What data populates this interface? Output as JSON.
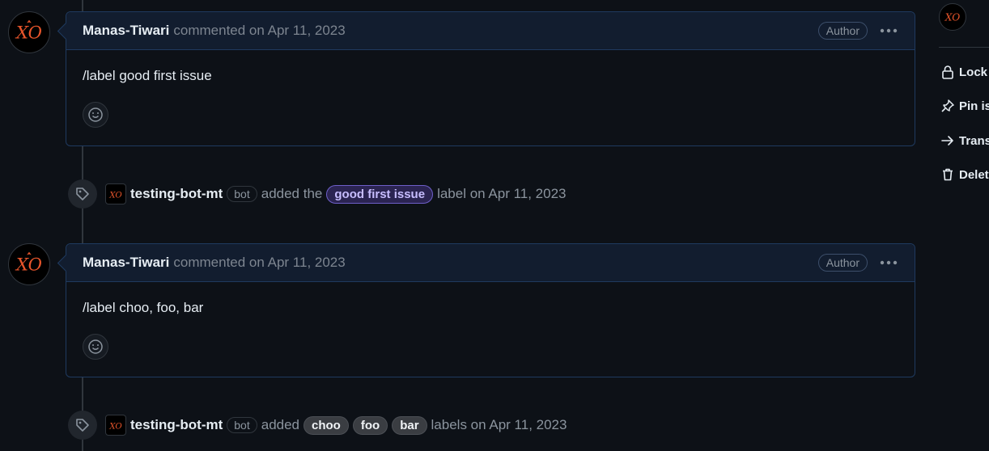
{
  "comments": [
    {
      "author": "Manas-Tiwari",
      "meta": "commented on Apr 11, 2023",
      "badge": "Author",
      "body": "/label good first issue"
    },
    {
      "author": "Manas-Tiwari",
      "meta": "commented on Apr 11, 2023",
      "badge": "Author",
      "body": "/label choo, foo, bar"
    }
  ],
  "events": [
    {
      "actor": "testing-bot-mt",
      "badge": "bot",
      "action": "added the",
      "labels": [
        "good first issue"
      ],
      "suffix": "label on Apr 11, 2023"
    },
    {
      "actor": "testing-bot-mt",
      "badge": "bot",
      "action": "added",
      "labels": [
        "choo",
        "foo",
        "bar"
      ],
      "suffix": "labels on Apr 11, 2023"
    }
  ],
  "sidebar": {
    "items": [
      {
        "label": "Lock c",
        "icon": "lock-icon"
      },
      {
        "label": "Pin iss",
        "icon": "pin-icon"
      },
      {
        "label": "Transf",
        "icon": "arrow-right-icon"
      },
      {
        "label": "Delete",
        "icon": "trash-icon"
      }
    ]
  },
  "colors": {
    "background": "#0d1117",
    "comment_header": "#121d2f",
    "comment_border": "#1f3a5f",
    "avatar_accent": "#e8552b",
    "label_good_first_issue": "#6e5fc9"
  }
}
